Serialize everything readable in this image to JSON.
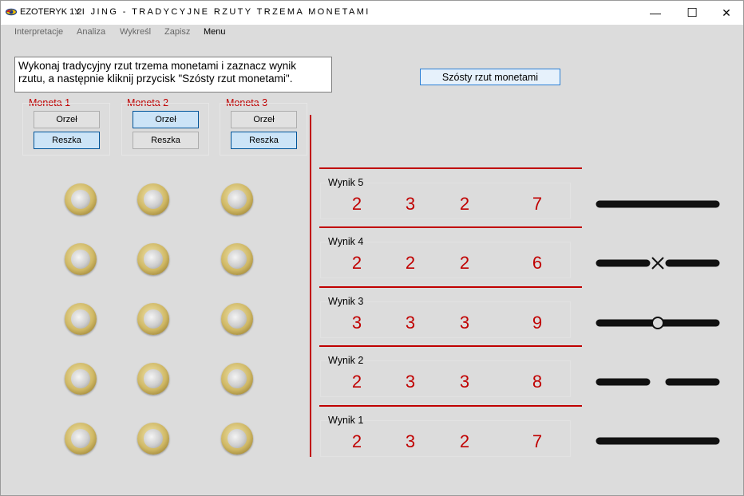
{
  "app": {
    "name": "EZOTERYK 1.2",
    "title": "YI JING - TRADYCYJNE RZUTY TRZEMA MONETAMI",
    "controls": {
      "minimize": "—",
      "maximize": "☐",
      "close": "✕"
    }
  },
  "menu": [
    {
      "label": "Interpretacje",
      "active": false
    },
    {
      "label": "Analiza",
      "active": false
    },
    {
      "label": "Wykreśl",
      "active": false
    },
    {
      "label": "Zapisz",
      "active": false
    },
    {
      "label": "Menu",
      "active": true
    }
  ],
  "instruction": {
    "line1": "Wykonaj tradycyjny rzut trzema monetami i zaznacz wynik",
    "line2": "rzutu, a następnie kliknij przycisk \"Szósty rzut monetami\"."
  },
  "action_button": "Szósty rzut monetami",
  "coins": [
    {
      "label": "Moneta 1",
      "orzel": "Orzeł",
      "reszka": "Reszka",
      "selected": "Reszka"
    },
    {
      "label": "Moneta 2",
      "orzel": "Orzeł",
      "reszka": "Reszka",
      "selected": "Orzeł"
    },
    {
      "label": "Moneta 3",
      "orzel": "Orzeł",
      "reszka": "Reszka",
      "selected": "Reszka"
    }
  ],
  "results": [
    {
      "label": "Wynik 5",
      "values": [
        "2",
        "3",
        "2",
        "7"
      ],
      "line": "yang"
    },
    {
      "label": "Wynik 4",
      "values": [
        "2",
        "2",
        "2",
        "6"
      ],
      "line": "yin-changing"
    },
    {
      "label": "Wynik 3",
      "values": [
        "3",
        "3",
        "3",
        "9"
      ],
      "line": "yang-changing"
    },
    {
      "label": "Wynik 2",
      "values": [
        "2",
        "3",
        "3",
        "8"
      ],
      "line": "yin"
    },
    {
      "label": "Wynik 1",
      "values": [
        "2",
        "3",
        "2",
        "7"
      ],
      "line": "yang"
    }
  ],
  "colors": {
    "accent_red": "#c00000",
    "button_blue": "#2a7fd4",
    "selected_fill": "#cce4f7"
  }
}
